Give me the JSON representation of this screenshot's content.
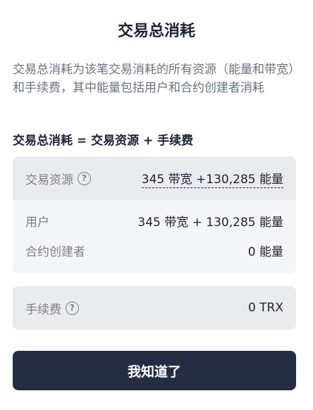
{
  "modal": {
    "title": "交易总消耗",
    "description": "交易总消耗为该笔交易消耗的所有资源（能量和带宽）和手续费，其中能量包括用户和合约创建者消耗",
    "formula": "交易总消耗 = 交易资源 + 手续费",
    "resources": {
      "label": "交易资源",
      "value": "345 带宽 +130,285 能量",
      "help_icon": "question-circle-icon",
      "rows": [
        {
          "label": "用户",
          "value": "345 带宽 + 130,285 能量"
        },
        {
          "label": "合约创建者",
          "value": "0 能量"
        }
      ]
    },
    "fee": {
      "label": "手续费",
      "value": "0 TRX",
      "help_icon": "question-circle-icon"
    },
    "confirm_button": "我知道了"
  }
}
